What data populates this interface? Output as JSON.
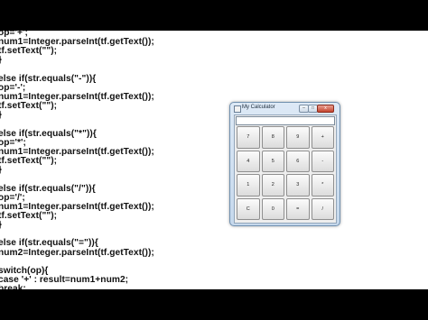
{
  "code_lines": [
    "op='+';",
    "num1=Integer.parseInt(tf.getText());",
    "tf.setText(\"\");",
    "}",
    "",
    "else if(str.equals(\"-\")){",
    "op='-';",
    "num1=Integer.parseInt(tf.getText());",
    "tf.setText(\"\");",
    "}",
    "",
    "else if(str.equals(\"*\")){",
    "op='*';",
    "num1=Integer.parseInt(tf.getText());",
    "tf.setText(\"\");",
    "}",
    "",
    "else if(str.equals(\"/\")){",
    "op='/';",
    "num1=Integer.parseInt(tf.getText());",
    "tf.setText(\"\");",
    "}",
    "",
    "else if(str.equals(\"=\")){",
    "num2=Integer.parseInt(tf.getText());",
    "",
    "switch(op){",
    "case '+' : result=num1+num2;",
    "break;"
  ],
  "calculator": {
    "title": "My Calculator",
    "controls": {
      "minimize": "–",
      "maximize": "□",
      "close": "x"
    },
    "display_value": "",
    "keys": [
      "7",
      "8",
      "9",
      "+",
      "4",
      "5",
      "6",
      "-",
      "1",
      "2",
      "3",
      "*",
      "C",
      "0",
      "=",
      "/"
    ]
  }
}
